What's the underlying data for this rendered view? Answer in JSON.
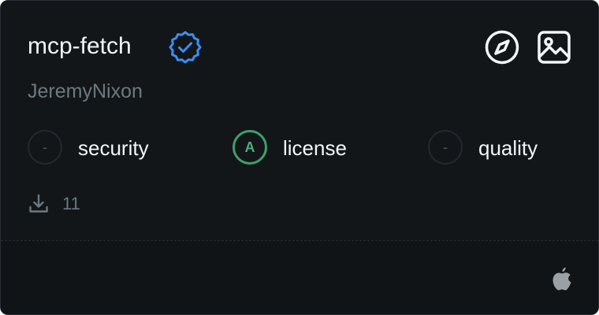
{
  "card": {
    "name": "mcp-fetch",
    "author": "JeremyNixon",
    "scores": [
      {
        "value": "-",
        "label": "security"
      },
      {
        "value": "A",
        "label": "license"
      },
      {
        "value": "-",
        "label": "quality"
      }
    ],
    "downloads": "11",
    "icons": {
      "verified": "verified-badge-icon",
      "explore": "compass-icon",
      "image": "image-icon",
      "downloads": "download-icon",
      "platform": "apple-icon"
    },
    "colors": {
      "background": "#121619",
      "verified": "#3b8ef0",
      "grade": "#3f9f6b",
      "muted": "#6c7a80"
    }
  }
}
